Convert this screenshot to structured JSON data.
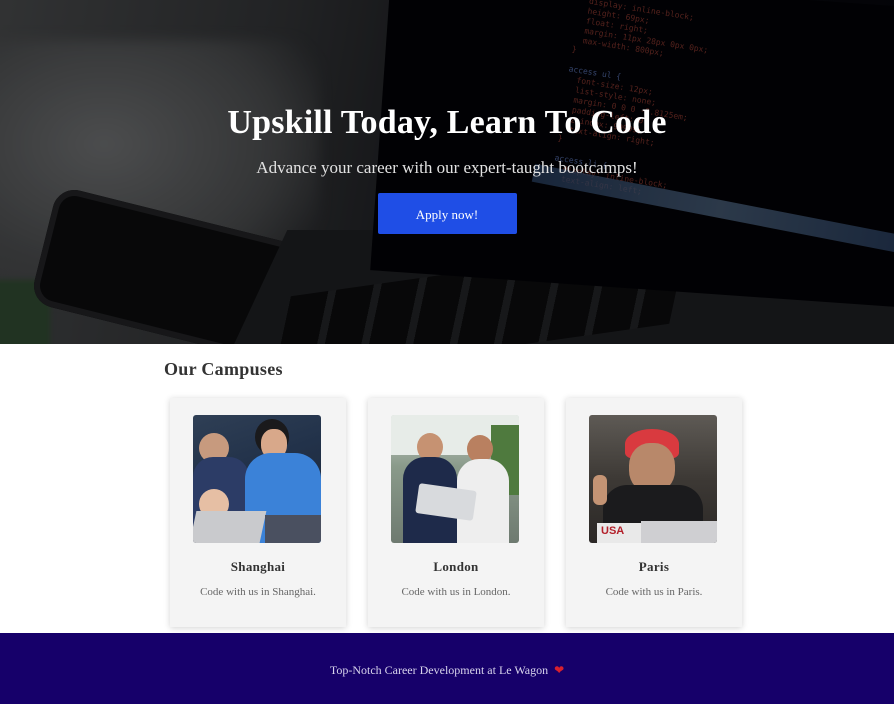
{
  "hero": {
    "title": "Upskill Today, Learn To Code",
    "subtitle": "Advance your career with our expert-taught bootcamps!",
    "cta_label": "Apply now!"
  },
  "campuses": {
    "section_title": "Our Campuses",
    "items": [
      {
        "name": "Shanghai",
        "description": "Code with us in Shanghai."
      },
      {
        "name": "London",
        "description": "Code with us in London."
      },
      {
        "name": "Paris",
        "description": "Code with us in Paris."
      }
    ]
  },
  "footer": {
    "text": "Top-Notch Career Development at Le Wagon",
    "icon": "heart-icon"
  },
  "colors": {
    "accent_button": "#1f4ee6",
    "footer_bg": "#16006a",
    "heart": "#d8202e"
  }
}
